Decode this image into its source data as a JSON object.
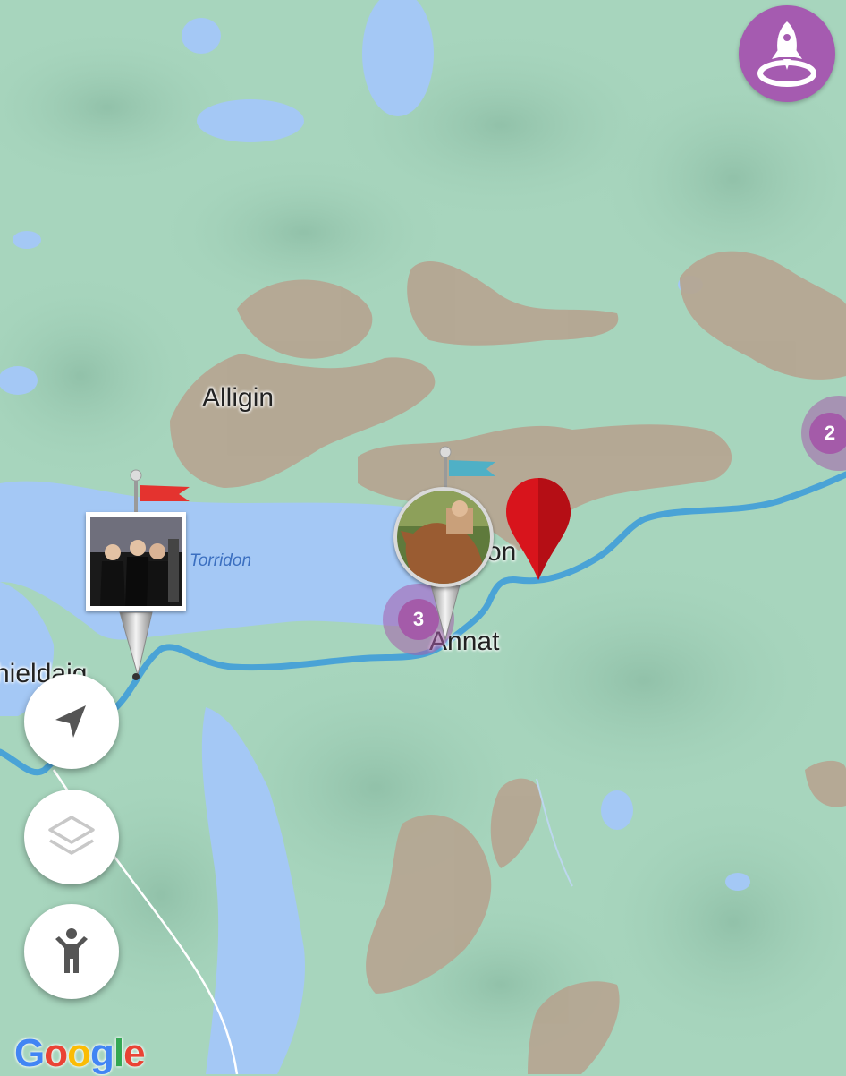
{
  "map": {
    "places": {
      "alligin": "Alligin",
      "torridon_water": "Torridon",
      "torridon_partial": "on",
      "annat": "Annat",
      "shieldaig_partial": "hieldaig"
    },
    "clusters": {
      "left": "3",
      "right": "2"
    },
    "attribution": {
      "letters": [
        "G",
        "o",
        "o",
        "g",
        "l",
        "e"
      ],
      "colors": [
        "#4285f4",
        "#ea4335",
        "#fbbc05",
        "#4285f4",
        "#34a853",
        "#ea4335"
      ]
    }
  },
  "controls": {
    "rocket_icon": "rocket-icon",
    "locate_icon": "navigation-arrow-icon",
    "layers_icon": "layers-icon",
    "person_icon": "person-icon"
  },
  "pins": {
    "photo_pin_left": {
      "flag_color": "#e4332f",
      "description_icon": "group-photo-thumbnail"
    },
    "photo_pin_right": {
      "flag_color": "#4fb0c6",
      "description_icon": "horse-photo-thumbnail"
    },
    "location_pin": {
      "color": "#d8141c"
    }
  },
  "colors": {
    "land": "#a7d5bd",
    "water": "#a4c8f5",
    "mountain": "#b5a692",
    "route": "#4aa3d6",
    "accent": "#a55bb0"
  }
}
